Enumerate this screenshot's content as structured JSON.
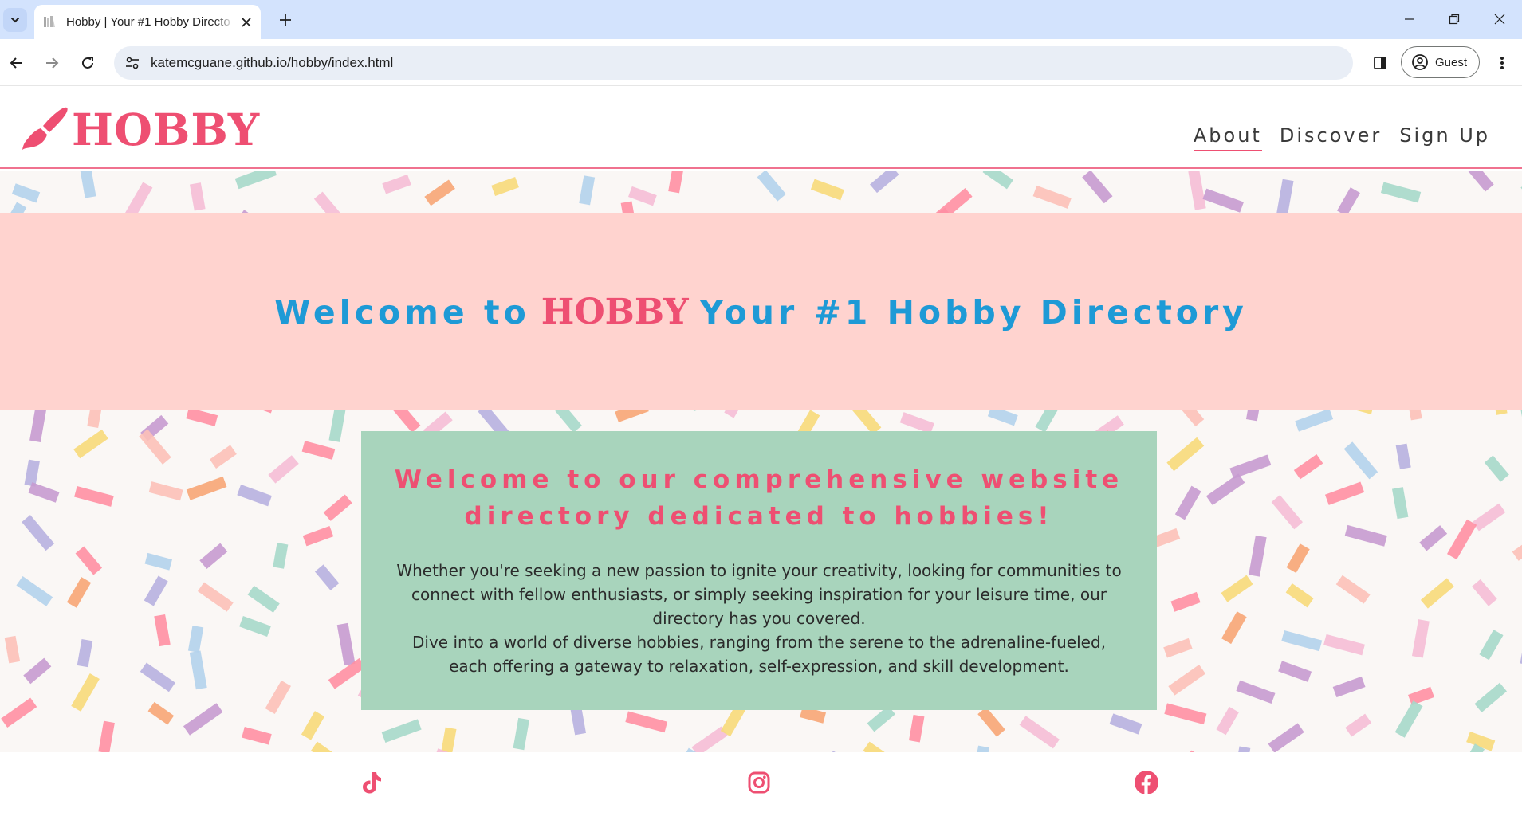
{
  "browser": {
    "tab_title": "Hobby | Your #1 Hobby Directory",
    "url": "katemcguane.github.io/hobby/index.html",
    "profile_label": "Guest"
  },
  "site": {
    "logo_text": "HOBBY",
    "nav": [
      {
        "label": "About",
        "active": true
      },
      {
        "label": "Discover",
        "active": false
      },
      {
        "label": "Sign Up",
        "active": false
      }
    ]
  },
  "hero": {
    "prefix": "Welcome to",
    "brand": "HOBBY",
    "suffix": "Your #1 Hobby Directory"
  },
  "intro": {
    "heading_line1": "Welcome to our comprehensive website",
    "heading_line2": "directory dedicated to hobbies!",
    "paragraph1": "Whether you're seeking a new passion to ignite your creativity, looking for communities to connect with fellow enthusiasts, or simply seeking inspiration for your leisure time, our directory has you covered.",
    "paragraph2": "Dive into a world of diverse hobbies, ranging from the serene to the adrenaline-fueled, each offering a gateway to relaxation, self-expression, and skill development."
  },
  "footer": {
    "social": [
      "tiktok-icon",
      "instagram-icon",
      "facebook-icon"
    ]
  },
  "colors": {
    "brand_pink": "#ee4f72",
    "hero_blue": "#1e9ad6",
    "hero_band": "#ffd3cf",
    "card_green": "#a8d4bc",
    "sprinkle_palette": [
      "#c79ad0",
      "#a6d8ca",
      "#f7d97a",
      "#b3d2ec",
      "#f5bdd6",
      "#ff8fa3",
      "#f7a575",
      "#b7b0e0",
      "#fcc0b8"
    ]
  }
}
